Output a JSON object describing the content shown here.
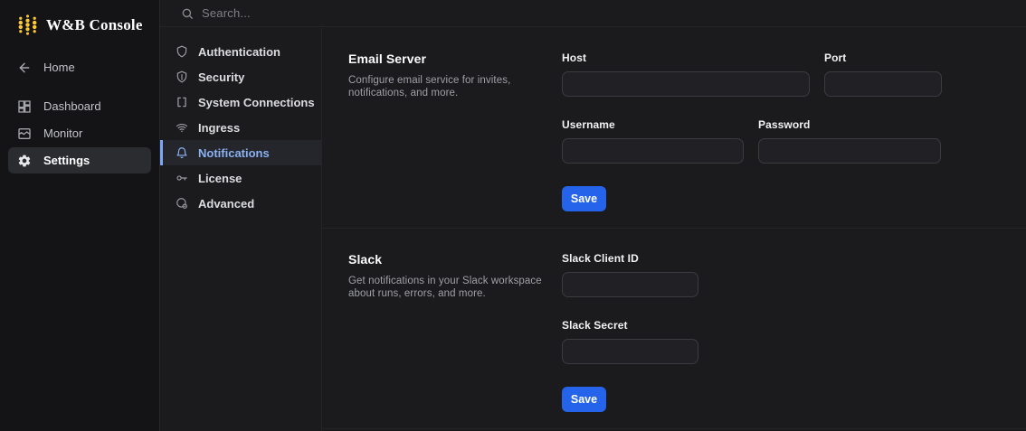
{
  "brand": {
    "title": "W&B Console"
  },
  "search": {
    "placeholder": "Search..."
  },
  "primary_nav": {
    "items": [
      {
        "label": "Home",
        "icon": "arrow-left-icon",
        "active": false
      },
      {
        "label": "Dashboard",
        "icon": "dashboard-icon",
        "active": false
      },
      {
        "label": "Monitor",
        "icon": "monitor-icon",
        "active": false
      },
      {
        "label": "Settings",
        "icon": "gear-icon",
        "active": true
      }
    ]
  },
  "settings_nav": {
    "items": [
      {
        "label": "Authentication",
        "icon": "shield-icon",
        "active": false
      },
      {
        "label": "Security",
        "icon": "shield-info-icon",
        "active": false
      },
      {
        "label": "System Connections",
        "icon": "brackets-icon",
        "active": false
      },
      {
        "label": "Ingress",
        "icon": "wifi-icon",
        "active": false
      },
      {
        "label": "Notifications",
        "icon": "bell-icon",
        "active": true
      },
      {
        "label": "License",
        "icon": "key-icon",
        "active": false
      },
      {
        "label": "Advanced",
        "icon": "advanced-gear-icon",
        "active": false
      }
    ]
  },
  "sections": [
    {
      "title": "Email Server",
      "description": "Configure email service for invites, notifications, and more.",
      "fields": [
        {
          "label": "Host",
          "value": ""
        },
        {
          "label": "Port",
          "value": ""
        },
        {
          "label": "Username",
          "value": ""
        },
        {
          "label": "Password",
          "value": ""
        }
      ],
      "save_label": "Save"
    },
    {
      "title": "Slack",
      "description": "Get notifications in your Slack workspace about runs, errors, and more.",
      "fields": [
        {
          "label": "Slack Client ID",
          "value": ""
        },
        {
          "label": "Slack Secret",
          "value": ""
        }
      ],
      "save_label": "Save"
    }
  ],
  "colors": {
    "accent_blue": "#2563eb",
    "selected_nav_blue": "#8ab1f1",
    "logo_gold": "#ffc933",
    "background": "#1b1b1d",
    "sidebar_background": "#141416"
  }
}
